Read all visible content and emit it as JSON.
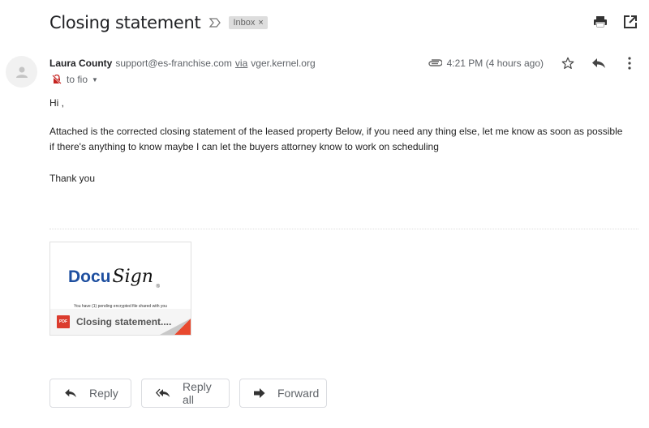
{
  "header": {
    "subject": "Closing statement",
    "label": "Inbox",
    "label_remove": "×"
  },
  "message": {
    "sender_name": "Laura County",
    "sender_email": "support@es-franchise.com",
    "via_label": "via",
    "via_domain": "vger.kernel.org",
    "to": "to fio",
    "time": "4:21 PM (4 hours ago)",
    "greeting": "Hi ,",
    "paragraph": "Attached is the corrected closing statement of the leased property Below, if you need any thing else, let me know as soon as possible if there's anything to know maybe I can let the buyers attorney know to work on scheduling",
    "signoff": "Thank you"
  },
  "attachment": {
    "brand_docu": "Docu",
    "brand_sign": "Sign",
    "brand_reg": "®",
    "preview_text": "You have (1) pending encrypted file shared with you",
    "file_type": "PDF",
    "file_name": "Closing statement...."
  },
  "actions": {
    "reply": "Reply",
    "reply_all": "Reply all",
    "forward": "Forward"
  },
  "colors": {
    "accent_red": "#db3b2d",
    "docusign_blue": "#1e4fa0",
    "label_bg": "#dddddd"
  }
}
